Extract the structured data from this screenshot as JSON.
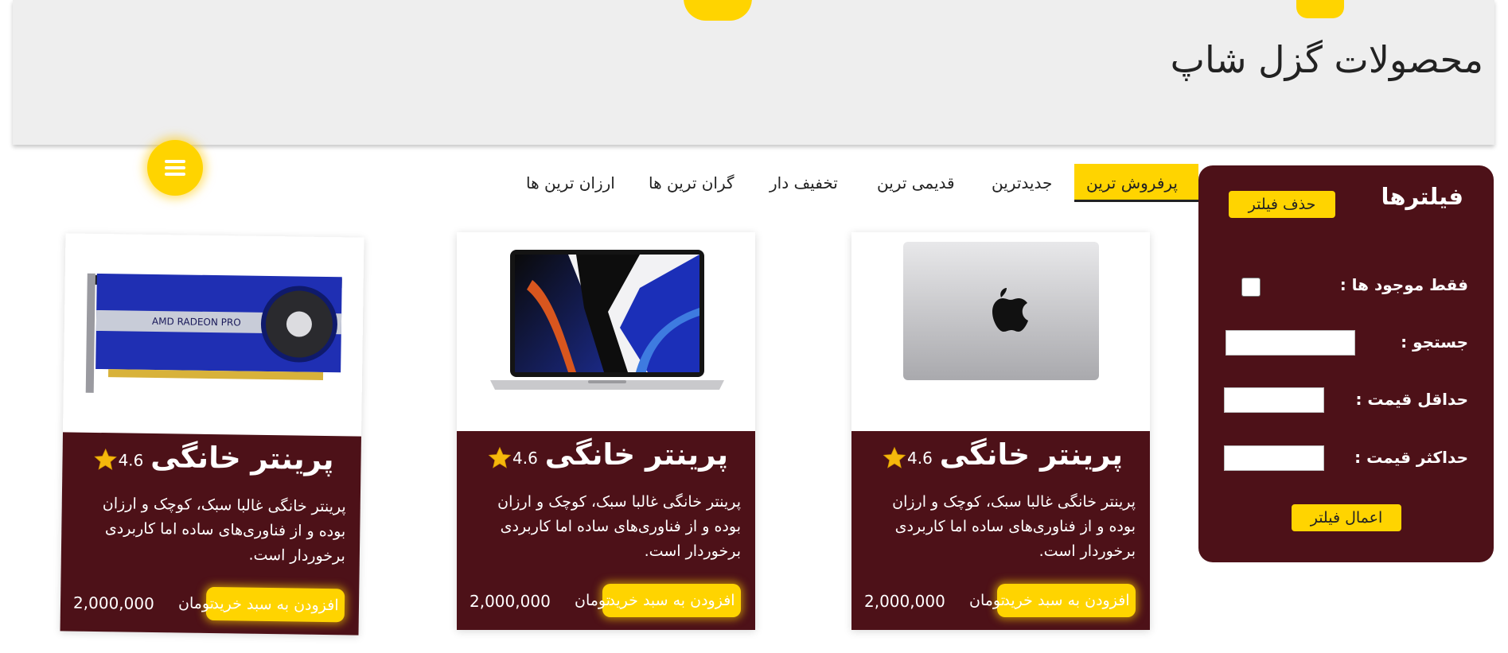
{
  "header": {
    "title": "محصولات گزل شاپ"
  },
  "menu": {
    "icon": "hamburger-icon"
  },
  "filters": {
    "title": "فیلترها",
    "clear_label": "حذف فیلتر",
    "in_stock_label": "فقط موجود ها :",
    "search_label": "جستجو :",
    "min_price_label": "حداقل قیمت :",
    "max_price_label": "حداکثر قیمت :",
    "apply_label": "اعمال فیلتر"
  },
  "sort_tabs": [
    {
      "label": "پرفروش ترین",
      "active": true
    },
    {
      "label": "جدیدترین"
    },
    {
      "label": "قدیمی ترین"
    },
    {
      "label": "تخفیف دار"
    },
    {
      "label": "گران ترین ها"
    },
    {
      "label": "ارزان ترین ها"
    }
  ],
  "products": [
    {
      "image": "macbook-lid-image",
      "title": "پرینتر خانگی",
      "rating": "4.6",
      "description": "پرینتر خانگی غالبا سبک، کوچک و ارزان بوده و از فناوری‌های ساده اما کاربردی برخوردار است.",
      "currency": "تومان",
      "price": "2,000,000",
      "add_label": "افزودن به سبد خرید"
    },
    {
      "image": "macbook-open-image",
      "title": "پرینتر خانگی",
      "rating": "4.6",
      "description": "پرینتر خانگی غالبا سبک، کوچک و ارزان بوده و از فناوری‌های ساده اما کاربردی برخوردار است.",
      "currency": "تومان",
      "price": "2,000,000",
      "add_label": "افزودن به سبد خرید"
    },
    {
      "image": "graphics-card-image",
      "image_text": "AMD RADEON PRO",
      "title": "پرینتر خانگی",
      "rating": "4.6",
      "description": "پرینتر خانگی غالبا سبک، کوچک و ارزان بوده و از فناوری‌های ساده اما کاربردی برخوردار است.",
      "currency": "تومان",
      "price": "2,000,000",
      "add_label": "افزودن به سبد خرید"
    }
  ],
  "colors": {
    "accent": "#ffd400",
    "panel": "#4d1118",
    "header_bg": "#eeeeee"
  }
}
